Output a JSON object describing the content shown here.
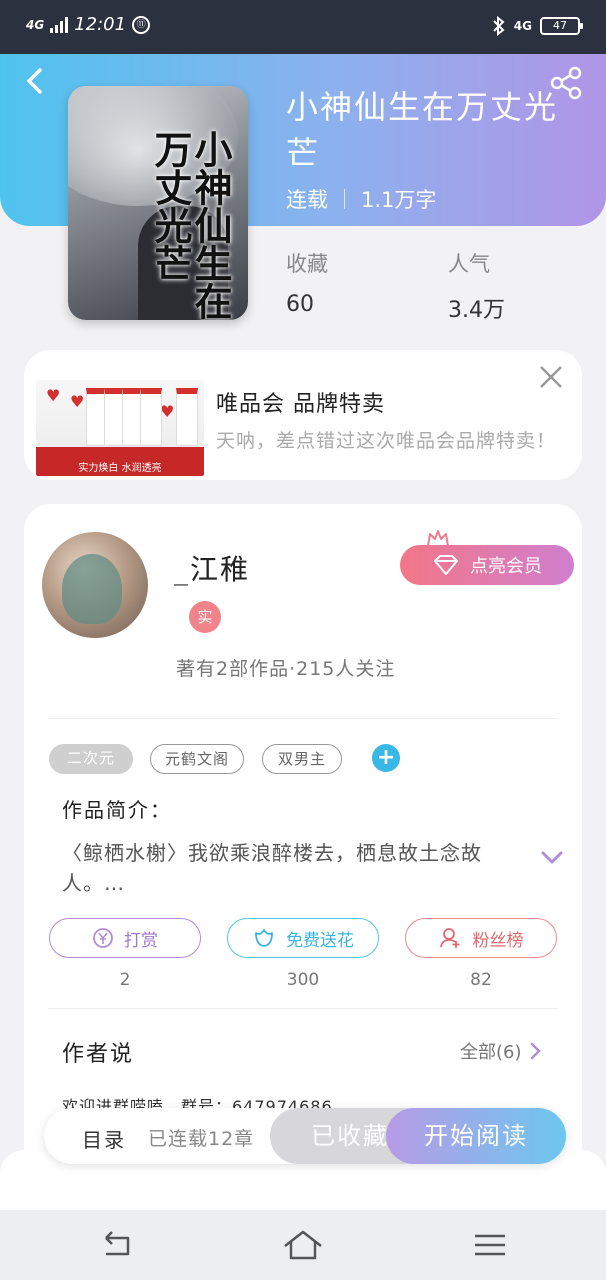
{
  "status_bar": {
    "network": "4G",
    "time": "12:01",
    "notif": "⑪",
    "network_right": "4G",
    "battery": "47"
  },
  "book": {
    "title": "小神仙生在万丈光芒",
    "status": "连载",
    "word_count": "1.1万字",
    "cover_title": "小神仙生在万丈光芒",
    "stats": [
      {
        "label": "收藏",
        "value": "60"
      },
      {
        "label": "人气",
        "value": "3.4万"
      }
    ]
  },
  "ad": {
    "title": "唯品会 品牌特卖",
    "description": "天呐，差点错过这次唯品会品牌特卖！",
    "image_caption": "实力焕白 水润透亮"
  },
  "author": {
    "name": "_江稚",
    "verified_badge": "实",
    "meta": "著有2部作品·215人关注",
    "vip_button": "点亮会员"
  },
  "tags": [
    "二次元",
    "元鹤文阁",
    "双男主"
  ],
  "add_tag": "+",
  "intro": {
    "label": "作品简介：",
    "text": "〈鲸栖水榭〉我欲乘浪醉楼去，栖息故土念故人。…"
  },
  "actions": [
    {
      "label": "打赏",
      "count": "2",
      "icon": "coin-icon"
    },
    {
      "label": "免费送花",
      "count": "300",
      "icon": "flower-icon"
    },
    {
      "label": "粉丝榜",
      "count": "82",
      "icon": "fans-icon"
    }
  ],
  "author_says": {
    "label": "作者说",
    "all_link": "全部(6)",
    "text": "欢迎进群唠嗑，群号：647974686"
  },
  "bottom_bar": {
    "toc": "目录",
    "toc_status": "已连载12章",
    "collected": "已收藏",
    "read": "开始阅读"
  },
  "colors": {
    "header_start": "#4fc3ee",
    "header_end": "#b195e6",
    "accent_blue": "#39b7e6",
    "accent_pink": "#f27687"
  }
}
